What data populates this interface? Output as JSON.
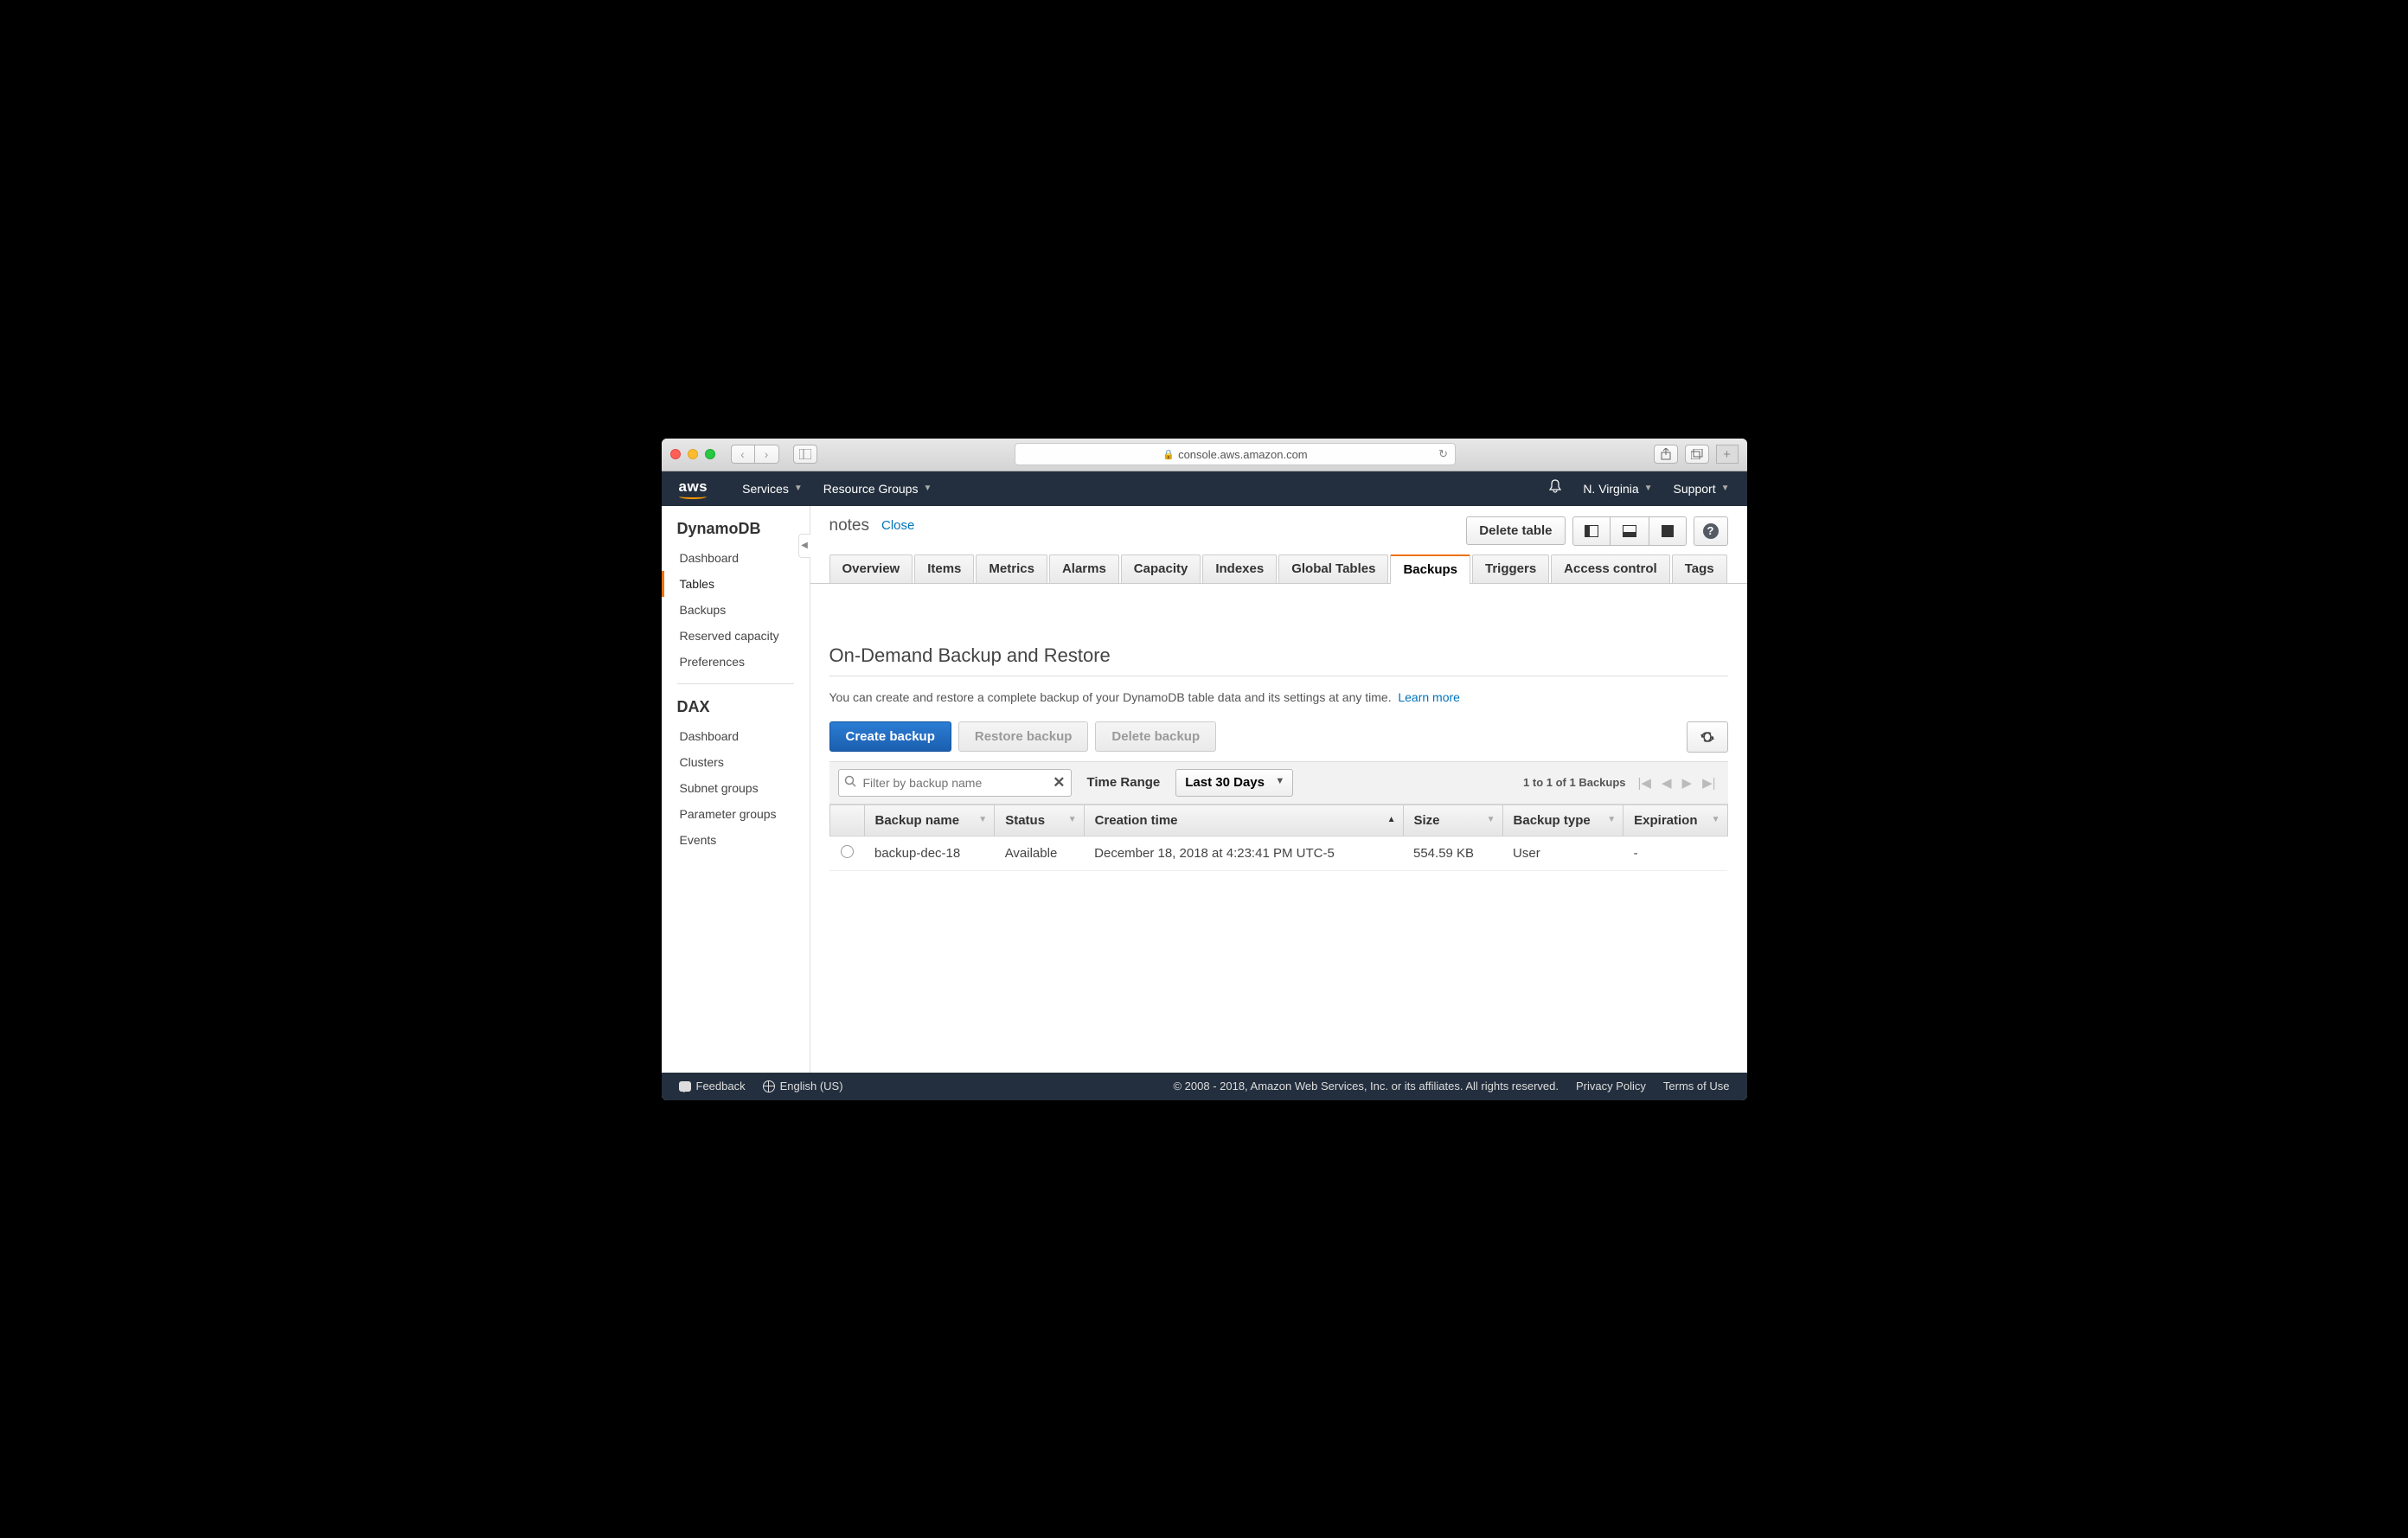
{
  "browser": {
    "url": "console.aws.amazon.com"
  },
  "aws_header": {
    "services": "Services",
    "resource_groups": "Resource Groups",
    "region": "N. Virginia",
    "support": "Support"
  },
  "sidebar": {
    "heading1": "DynamoDB",
    "items1": [
      "Dashboard",
      "Tables",
      "Backups",
      "Reserved capacity",
      "Preferences"
    ],
    "active1": 1,
    "heading2": "DAX",
    "items2": [
      "Dashboard",
      "Clusters",
      "Subnet groups",
      "Parameter groups",
      "Events"
    ]
  },
  "content_header": {
    "table_name": "notes",
    "close": "Close",
    "delete_table": "Delete table"
  },
  "tabs": [
    "Overview",
    "Items",
    "Metrics",
    "Alarms",
    "Capacity",
    "Indexes",
    "Global Tables",
    "Backups",
    "Triggers",
    "Access control",
    "Tags"
  ],
  "active_tab": 7,
  "backup_section": {
    "title": "On-Demand Backup and Restore",
    "desc": "You can create and restore a complete backup of your DynamoDB table data and its settings at any time.",
    "learn_more": "Learn more",
    "create": "Create backup",
    "restore": "Restore backup",
    "delete": "Delete backup",
    "filter_placeholder": "Filter by backup name",
    "time_range_label": "Time Range",
    "time_range_value": "Last 30 Days",
    "pagination": "1 to 1 of 1 Backups",
    "columns": [
      "Backup name",
      "Status",
      "Creation time",
      "Size",
      "Backup type",
      "Expiration"
    ],
    "rows": [
      {
        "name": "backup-dec-18",
        "status": "Available",
        "creation": "December 18, 2018 at 4:23:41 PM UTC-5",
        "size": "554.59 KB",
        "type": "User",
        "expiration": "-"
      }
    ]
  },
  "footer": {
    "feedback": "Feedback",
    "language": "English (US)",
    "copyright": "© 2008 - 2018, Amazon Web Services, Inc. or its affiliates. All rights reserved.",
    "privacy": "Privacy Policy",
    "terms": "Terms of Use"
  }
}
